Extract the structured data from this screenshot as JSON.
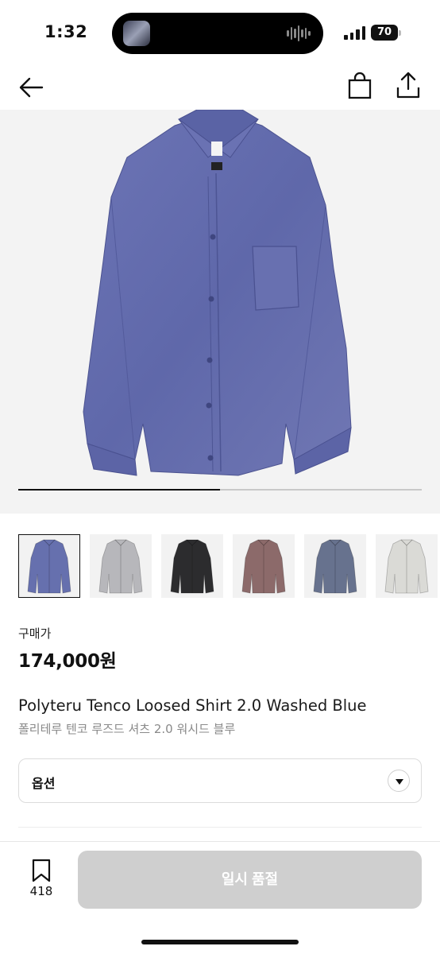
{
  "status_bar": {
    "time": "1:32",
    "battery": "70"
  },
  "nav": {
    "back_icon": "arrow-left-icon",
    "bag_icon": "shopping-bag-icon",
    "share_icon": "share-icon"
  },
  "gallery": {
    "image_progress": 0.5,
    "thumbnails": [
      {
        "color": "#6670ae",
        "selected": true
      },
      {
        "color": "#b7b7bb",
        "selected": false
      },
      {
        "color": "#2c2c2e",
        "selected": false
      },
      {
        "color": "#8c6a6a",
        "selected": false
      },
      {
        "color": "#67728e",
        "selected": false
      },
      {
        "color": "#dadad6",
        "selected": false
      }
    ]
  },
  "price": {
    "label": "구매가",
    "value": "174,000원"
  },
  "product": {
    "name_en": "Polyteru Tenco Loosed Shirt 2.0 Washed Blue",
    "name_ko": "폴리테루 텐코 루즈드 셔츠 2.0 워시드 블루"
  },
  "option": {
    "label": "옵션",
    "icon": "chevron-down-icon"
  },
  "bottom_bar": {
    "wish_icon": "bookmark-icon",
    "wish_count": "418",
    "button_label": "일시 품절",
    "button_color": "#cfcfcf"
  }
}
